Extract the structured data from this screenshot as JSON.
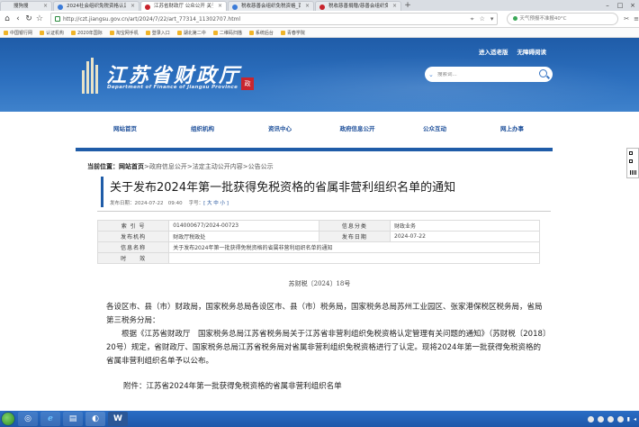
{
  "browser": {
    "tabs": [
      {
        "title": "搜狗搜",
        "active": false,
        "favicon": "blue"
      },
      {
        "title": "2024社会组织免税资格认定办…",
        "active": false,
        "favicon": "blue"
      },
      {
        "title": "江苏省财政厅 公众公开 关于…",
        "active": true,
        "favicon": "red"
      },
      {
        "title": "税收慈善会组织免税资格_百度…",
        "active": false,
        "favicon": "blue"
      },
      {
        "title": "税收慈善捐赠/慈善会组织免税…",
        "active": false,
        "favicon": "red"
      }
    ],
    "new_tab": "+",
    "url": "http://czt.jiangsu.gov.cn/art/2024/7/22/art_77314_11302707.html",
    "weather": "天气预报不准报40°C",
    "bookmarks": [
      "中国银行网",
      "认证机构",
      "2020年国际",
      "淘宝网手机",
      "登录入口",
      "湖北第二中",
      "二维码扫描",
      "系统后台",
      "青春学院"
    ]
  },
  "site": {
    "logo_cn": "江苏省财政厅",
    "logo_en": "Department of Finance of Jiangsu Province",
    "seal_char": "政",
    "top_links": [
      "进入适老版",
      "无障碍阅读"
    ],
    "search_placeholder": "搜索词..."
  },
  "nav": [
    "网站首页",
    "组织机构",
    "资讯中心",
    "政府信息公开",
    "公众互动",
    "网上办事"
  ],
  "breadcrumb": {
    "label": "当前位置：",
    "items": [
      "网站首页",
      "政府信息公开",
      "法定主动公开内容",
      "公告公示"
    ],
    "sep": ">"
  },
  "doc": {
    "title": "关于发布2024年第一批获得免税资格的省属非营利组织名单的通知",
    "pub_date_label": "发布日期：",
    "pub_date": "2024-07-22",
    "pub_time": "09:40",
    "font_label": "字号：",
    "font_sizes": "[ 大 中 小 ]"
  },
  "info": {
    "rows": [
      {
        "k1": "索 引 号",
        "v1": "014000677/2024-00723",
        "k2": "信息分类",
        "v2": "财政业务"
      },
      {
        "k1": "发布机构",
        "v1": "财政厅税政处",
        "k2": "发布日期",
        "v2": "2024-07-22"
      },
      {
        "k1": "信息名称",
        "v1": "关于发布2024年第一批获得免税资格的省属非营利组织名单的通知",
        "k2": "",
        "v2": ""
      },
      {
        "k1": "时　　效",
        "v1": "",
        "k2": "",
        "v2": ""
      }
    ]
  },
  "content": {
    "doc_number": "苏财税〔2024〕18号",
    "greeting": "各设区市、县（市）财政局，国家税务总局各设区市、县（市）税务局，国家税务总局苏州工业园区、张家港保税区税务局，省局第三税务分局：",
    "body": "根据《江苏省财政厅　国家税务总局江苏省税务局关于江苏省非营利组织免税资格认定管理有关问题的通知》（苏财税〔2018〕20号）规定，省财政厅、国家税务总局江苏省税务局对省属非营利组织免税资格进行了认定。现将2024年第一批获得免税资格的省属非营利组织名单予以公布。",
    "attachment": "附件：江苏省2024年第一批获得免税资格的省属非营利组织名单"
  }
}
